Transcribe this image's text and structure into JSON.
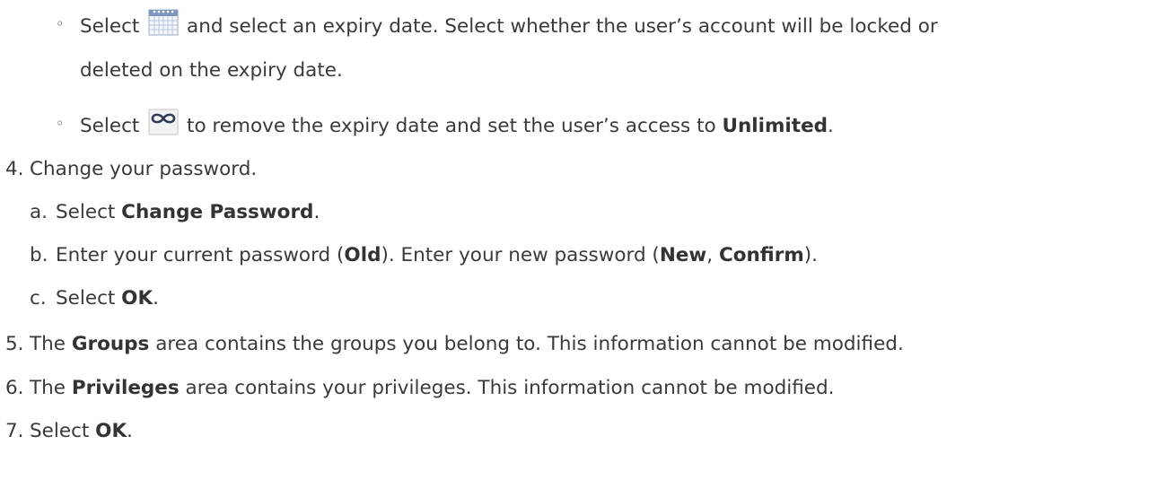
{
  "bullets": {
    "marker": "◦",
    "calendar": {
      "icon": "calendar-icon",
      "pre": "Select",
      "post": "and select an expiry date. Select whether the user’s account will be locked or",
      "cont": "deleted on the expiry date."
    },
    "unlimited": {
      "icon": "infinity-icon",
      "pre": "Select",
      "post": "to remove the expiry date and set the user’s access to",
      "bold": "Unlimited",
      "end": "."
    }
  },
  "steps": {
    "s4": {
      "num": "4.",
      "text": "Change your password.",
      "sub": {
        "a": {
          "label": "a.",
          "pre": "Select",
          "bold": "Change Password",
          "end": "."
        },
        "b": {
          "label": "b.",
          "t1": "Enter your current password (",
          "b1": "Old",
          "t2": "). Enter your new password (",
          "b2": "New",
          "t3": ", ",
          "b3": "Confirm",
          "t4": ")."
        },
        "c": {
          "label": "c.",
          "pre": "Select",
          "bold": "OK",
          "end": "."
        }
      }
    },
    "s5": {
      "num": "5.",
      "pre": "The",
      "bold": "Groups",
      "post": "area contains the groups you belong to. This information cannot be modified."
    },
    "s6": {
      "num": "6.",
      "pre": "The",
      "bold": "Privileges",
      "post": "area contains your privileges. This information cannot be modified."
    },
    "s7": {
      "num": "7.",
      "pre": "Select",
      "bold": "OK",
      "end": "."
    }
  }
}
